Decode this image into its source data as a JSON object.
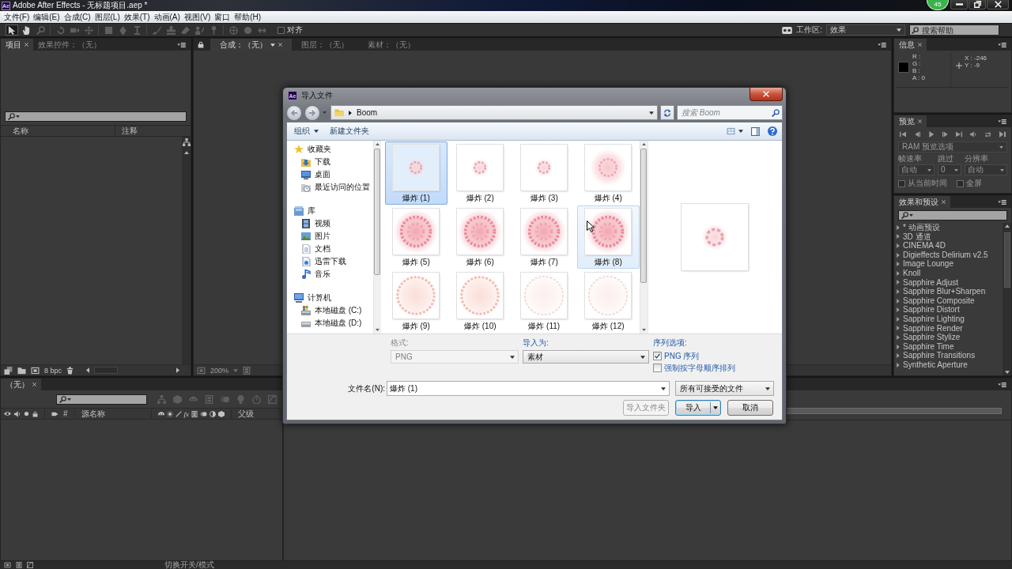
{
  "window": {
    "logo": "Ae",
    "title": "Adobe After Effects - 无标题项目.aep *",
    "badge": "45"
  },
  "menu": [
    "文件(F)",
    "编辑(E)",
    "合成(C)",
    "图层(L)",
    "效果(T)",
    "动画(A)",
    "视图(V)",
    "窗口",
    "帮助(H)"
  ],
  "toolbar": {
    "tools": [
      {
        "kind": "select",
        "selected": true,
        "disabled": false
      },
      {
        "kind": "hand",
        "selected": false,
        "disabled": false
      },
      {
        "kind": "zoom",
        "selected": false,
        "disabled": true
      },
      {
        "kind": "rotate",
        "selected": false,
        "disabled": true
      },
      {
        "kind": "orbit",
        "selected": false,
        "disabled": true
      },
      {
        "kind": "pan",
        "selected": false,
        "disabled": true
      },
      {
        "kind": "rectangle",
        "selected": false,
        "disabled": true
      },
      {
        "kind": "pen",
        "selected": false,
        "disabled": true
      },
      {
        "kind": "type",
        "selected": false,
        "disabled": true
      },
      {
        "kind": "brush",
        "selected": false,
        "disabled": true
      },
      {
        "kind": "stamp",
        "selected": false,
        "disabled": true
      },
      {
        "kind": "eraser",
        "selected": false,
        "disabled": true
      },
      {
        "kind": "roto",
        "selected": false,
        "disabled": true
      },
      {
        "kind": "pin",
        "selected": false,
        "disabled": true
      },
      {
        "kind": "axis-local",
        "selected": false,
        "disabled": true
      },
      {
        "kind": "axis-world",
        "selected": false,
        "disabled": true
      },
      {
        "kind": "axis-view",
        "selected": false,
        "disabled": true
      }
    ],
    "snap": {
      "label": "对齐",
      "checked": false
    },
    "workspace_label": "工作区:",
    "workspace": "效果",
    "help_search": {
      "placeholder": "搜索帮助"
    }
  },
  "project_panel": {
    "tabs": [
      {
        "label": "项目",
        "selected": true
      },
      {
        "label": "效果控件：（无）",
        "selected": false
      }
    ],
    "columns": [
      "名称",
      "注释"
    ],
    "bit_depth": "8 bpc"
  },
  "viewer_panel": {
    "tabs": [
      {
        "label": "合成：（无）",
        "selected": true
      },
      {
        "label": "图层：（无）",
        "selected": false
      },
      {
        "label": "素材：（无）",
        "selected": false
      }
    ],
    "zoom": "200%"
  },
  "info_panel": {
    "tab": "信息",
    "color_values": [
      "R :",
      "G :",
      "B :",
      "A : 0"
    ],
    "position": [
      "X : -246",
      "Y : -9"
    ]
  },
  "preview_panel": {
    "tab": "预览",
    "disabled": true,
    "options": "RAM 预览选项",
    "fields": [
      {
        "label": "帧速率",
        "value": "自动"
      },
      {
        "label": "跳过",
        "value": "0"
      },
      {
        "label": "分辨率",
        "value": "自动"
      }
    ],
    "checks": [
      {
        "label": "从当前时间",
        "checked": false
      },
      {
        "label": "全屏",
        "checked": false
      }
    ]
  },
  "effects_panel": {
    "tab": "效果和预设",
    "items": [
      {
        "label": "* 动画预设",
        "expanded": false
      },
      {
        "label": "3D 通道",
        "expanded": false
      },
      {
        "label": "CINEMA 4D",
        "expanded": false
      },
      {
        "label": "Digieffects Delirium v2.5",
        "expanded": false
      },
      {
        "label": "Image Lounge",
        "expanded": false
      },
      {
        "label": "Knoll",
        "expanded": false
      },
      {
        "label": "Sapphire Adjust",
        "expanded": false
      },
      {
        "label": "Sapphire Blur+Sharpen",
        "expanded": false
      },
      {
        "label": "Sapphire Composite",
        "expanded": false
      },
      {
        "label": "Sapphire Distort",
        "expanded": false
      },
      {
        "label": "Sapphire Lighting",
        "expanded": false
      },
      {
        "label": "Sapphire Render",
        "expanded": false
      },
      {
        "label": "Sapphire Stylize",
        "expanded": false
      },
      {
        "label": "Sapphire Time",
        "expanded": false
      },
      {
        "label": "Sapphire Transitions",
        "expanded": false
      },
      {
        "label": "Synthetic Aperture",
        "expanded": false
      }
    ]
  },
  "timeline": {
    "tab": "（无）",
    "columns": [
      "#",
      "源名称",
      "父级"
    ],
    "switch_text": "fx",
    "mode_toggle": "切换开关/模式"
  },
  "dialog": {
    "logo": "Ae",
    "title": "导入文件",
    "path": "Boom",
    "search": {
      "placeholder": "搜索 Boom"
    },
    "commands": [
      {
        "label": "组织",
        "menu": true
      },
      {
        "label": "新建文件夹",
        "menu": false
      }
    ],
    "nav": [
      {
        "label": "收藏夹",
        "kind": "favorites",
        "children": [
          {
            "label": "下载",
            "kind": "downloads"
          },
          {
            "label": "桌面",
            "kind": "desktop"
          },
          {
            "label": "最近访问的位置",
            "kind": "recent"
          }
        ]
      },
      {
        "label": "库",
        "kind": "library",
        "children": [
          {
            "label": "视频",
            "kind": "videos"
          },
          {
            "label": "图片",
            "kind": "pictures"
          },
          {
            "label": "文档",
            "kind": "documents"
          },
          {
            "label": "迅雷下载",
            "kind": "thunder"
          },
          {
            "label": "音乐",
            "kind": "music"
          }
        ]
      },
      {
        "label": "计算机",
        "kind": "computer",
        "children": [
          {
            "label": "本地磁盘 (C:)",
            "kind": "system-drive"
          },
          {
            "label": "本地磁盘 (D:)",
            "kind": "drive"
          }
        ]
      }
    ],
    "files": [
      {
        "name": "爆炸 (1)",
        "kind": "small-ring",
        "selected": true,
        "hovered": false
      },
      {
        "name": "爆炸 (2)",
        "kind": "small-ring",
        "selected": false,
        "hovered": false
      },
      {
        "name": "爆炸 (3)",
        "kind": "small-ring",
        "selected": false,
        "hovered": false
      },
      {
        "name": "爆炸 (4)",
        "kind": "glow-ring",
        "selected": false,
        "hovered": false
      },
      {
        "name": "爆炸 (5)",
        "kind": "burst",
        "selected": false,
        "hovered": false
      },
      {
        "name": "爆炸 (6)",
        "kind": "burst",
        "selected": false,
        "hovered": false
      },
      {
        "name": "爆炸 (7)",
        "kind": "burst",
        "selected": false,
        "hovered": false
      },
      {
        "name": "爆炸 (8)",
        "kind": "burst",
        "selected": false,
        "hovered": true
      },
      {
        "name": "爆炸 (9)",
        "kind": "fading",
        "selected": false,
        "hovered": false
      },
      {
        "name": "爆炸 (10)",
        "kind": "fading",
        "selected": false,
        "hovered": false
      },
      {
        "name": "爆炸 (11)",
        "kind": "faint",
        "selected": false,
        "hovered": false
      },
      {
        "name": "爆炸 (12)",
        "kind": "faint",
        "selected": false,
        "hovered": false
      }
    ],
    "format": {
      "label": "格式:",
      "value": "PNG",
      "disabled": true
    },
    "import_as": {
      "label": "导入为:",
      "value": "素材"
    },
    "sequence": {
      "label": "序列选项:",
      "options": [
        {
          "label": "PNG 序列",
          "checked": true
        },
        {
          "label": "强制按字母顺序排列",
          "checked": false
        }
      ]
    },
    "filename": {
      "label": "文件名(N):",
      "value": "爆炸 (1)"
    },
    "file_type": "所有可接受的文件",
    "buttons": [
      {
        "label": "导入文件夹",
        "kind": "plain",
        "disabled": true
      },
      {
        "label": "导入",
        "kind": "split",
        "disabled": false
      },
      {
        "label": "取消",
        "kind": "plain",
        "disabled": false
      }
    ]
  }
}
